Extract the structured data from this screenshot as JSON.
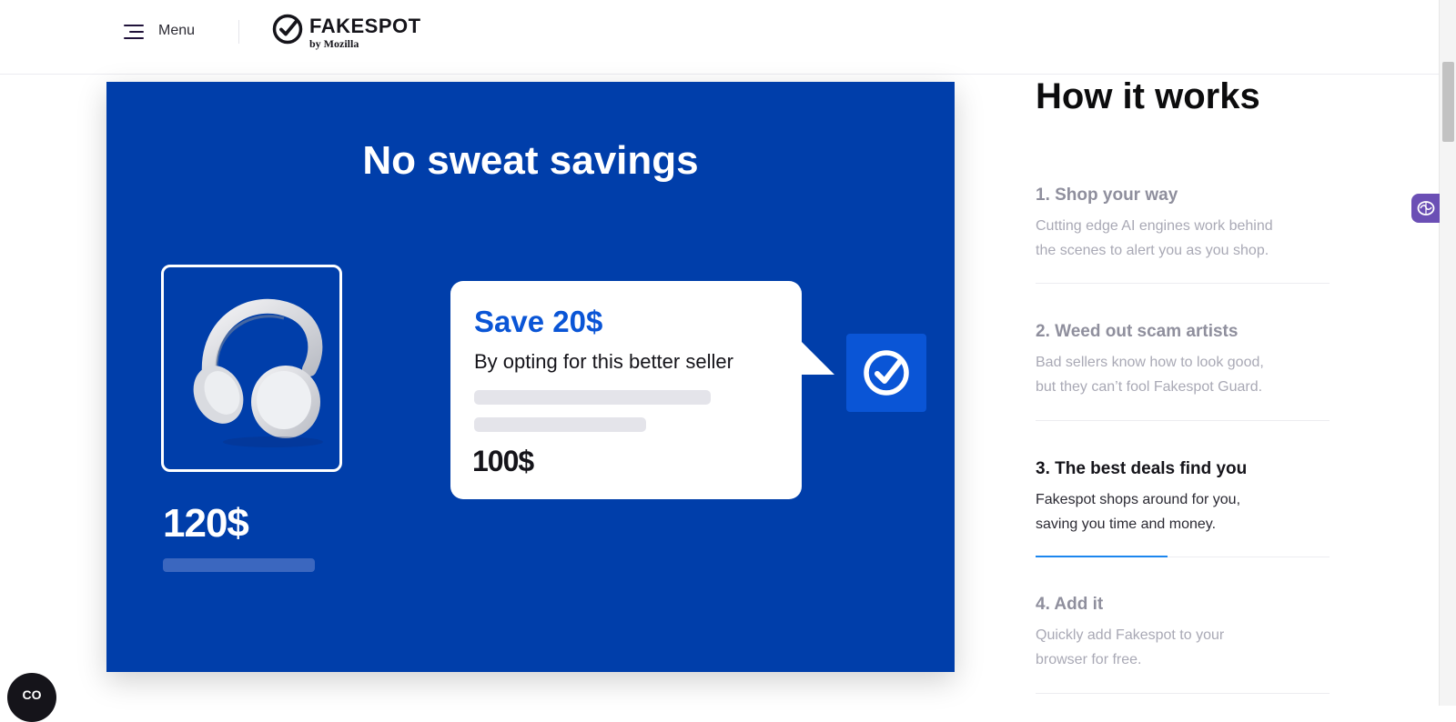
{
  "header": {
    "menu_label": "Menu",
    "logo_title": "FAKESPOT",
    "logo_subtitle": "by Mozilla",
    "icons": {
      "menu": "hamburger-icon",
      "logo": "check-circle-icon"
    }
  },
  "promo": {
    "title": "No sweat savings",
    "old_price": "120$",
    "bubble": {
      "save_title": "Save 20$",
      "save_subtitle": "By opting for this better seller",
      "new_price": "100$"
    },
    "background_color": "#003eaa",
    "accent_color": "#0a55d6",
    "icons": {
      "product": "headphones-icon",
      "badge": "check-circle-icon"
    }
  },
  "how_it_works": {
    "title": "How it works",
    "steps": [
      {
        "title": "1. Shop your way",
        "desc_line1": "Cutting edge AI engines work behind",
        "desc_line2": "the scenes to alert you as you shop."
      },
      {
        "title": "2. Weed out scam artists",
        "desc_line1": "Bad sellers know how to look good,",
        "desc_line2": "but they can’t fool Fakespot Guard."
      },
      {
        "title": "3. The best deals find you",
        "desc_line1": "Fakespot shops around for you,",
        "desc_line2": "saving you time and money."
      },
      {
        "title": "4. Add it",
        "desc_line1": "Quickly add Fakespot to your",
        "desc_line2": "browser for free."
      }
    ],
    "active_step": 3,
    "active_progress_fraction": 0.45,
    "progress_color": "#1c86ee"
  },
  "floating": {
    "side_tab_icon": "brain-icon",
    "chat_icon": "chat-icon",
    "chat_glyph": "CO"
  }
}
